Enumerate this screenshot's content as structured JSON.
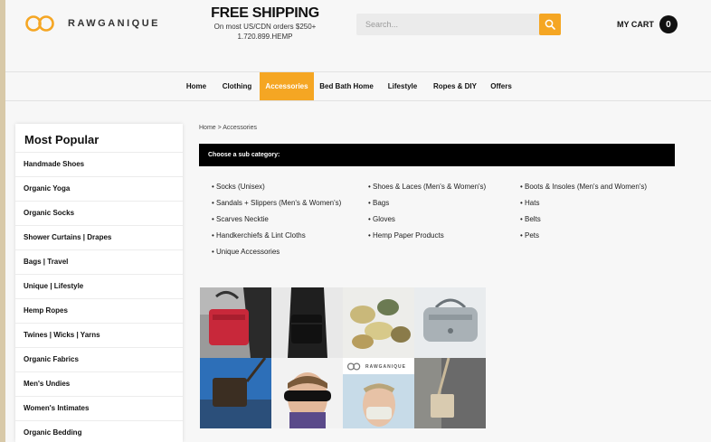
{
  "header": {
    "logo_text": "RAWGANIQUE",
    "shipping_title": "FREE SHIPPING",
    "shipping_line1": "On most US/CDN orders $250+",
    "shipping_line2": "1.720.899.HEMP",
    "search_placeholder": "Search...",
    "cart_label": "MY CART",
    "cart_count": "0"
  },
  "nav": {
    "items": [
      {
        "label": "Home"
      },
      {
        "label": "Clothing"
      },
      {
        "label": "Accessories",
        "active": true
      },
      {
        "label": "Bed Bath Home"
      },
      {
        "label": "Lifestyle"
      },
      {
        "label": "Ropes & DIY"
      },
      {
        "label": "Offers"
      }
    ]
  },
  "sidebar": {
    "title": "Most Popular",
    "items": [
      {
        "label": "Handmade Shoes"
      },
      {
        "label": "Organic Yoga"
      },
      {
        "label": "Organic Socks"
      },
      {
        "label": "Shower Curtains | Drapes"
      },
      {
        "label": "Bags | Travel"
      },
      {
        "label": "Unique | Lifestyle"
      },
      {
        "label": "Hemp Ropes"
      },
      {
        "label": "Twines | Wicks | Yarns"
      },
      {
        "label": "Organic Fabrics"
      },
      {
        "label": "Men's Undies"
      },
      {
        "label": "Women's Intimates"
      },
      {
        "label": "Organic Bedding"
      }
    ]
  },
  "main": {
    "breadcrumb": "Home > Accessories",
    "subcategory_heading": "Choose a sub category:",
    "subcategories": {
      "col1": [
        "• Socks (Unisex)",
        "• Sandals + Slippers (Men's & Women's)",
        "• Scarves Necktie",
        "• Handkerchiefs & Lint Cloths",
        "• Unique Accessories"
      ],
      "col2": [
        "• Shoes & Laces (Men's & Women's)",
        "• Bags",
        "• Gloves",
        "• Hemp Paper Products"
      ],
      "col3": [
        "• Boots & Insoles (Men's and Women's)",
        "• Hats",
        "• Belts",
        "• Pets"
      ]
    },
    "collage_logo_text": "RAWGANIQUE"
  },
  "colors": {
    "accent": "#f5a623",
    "black_bar": "#000000",
    "background": "#f7f7f7"
  }
}
